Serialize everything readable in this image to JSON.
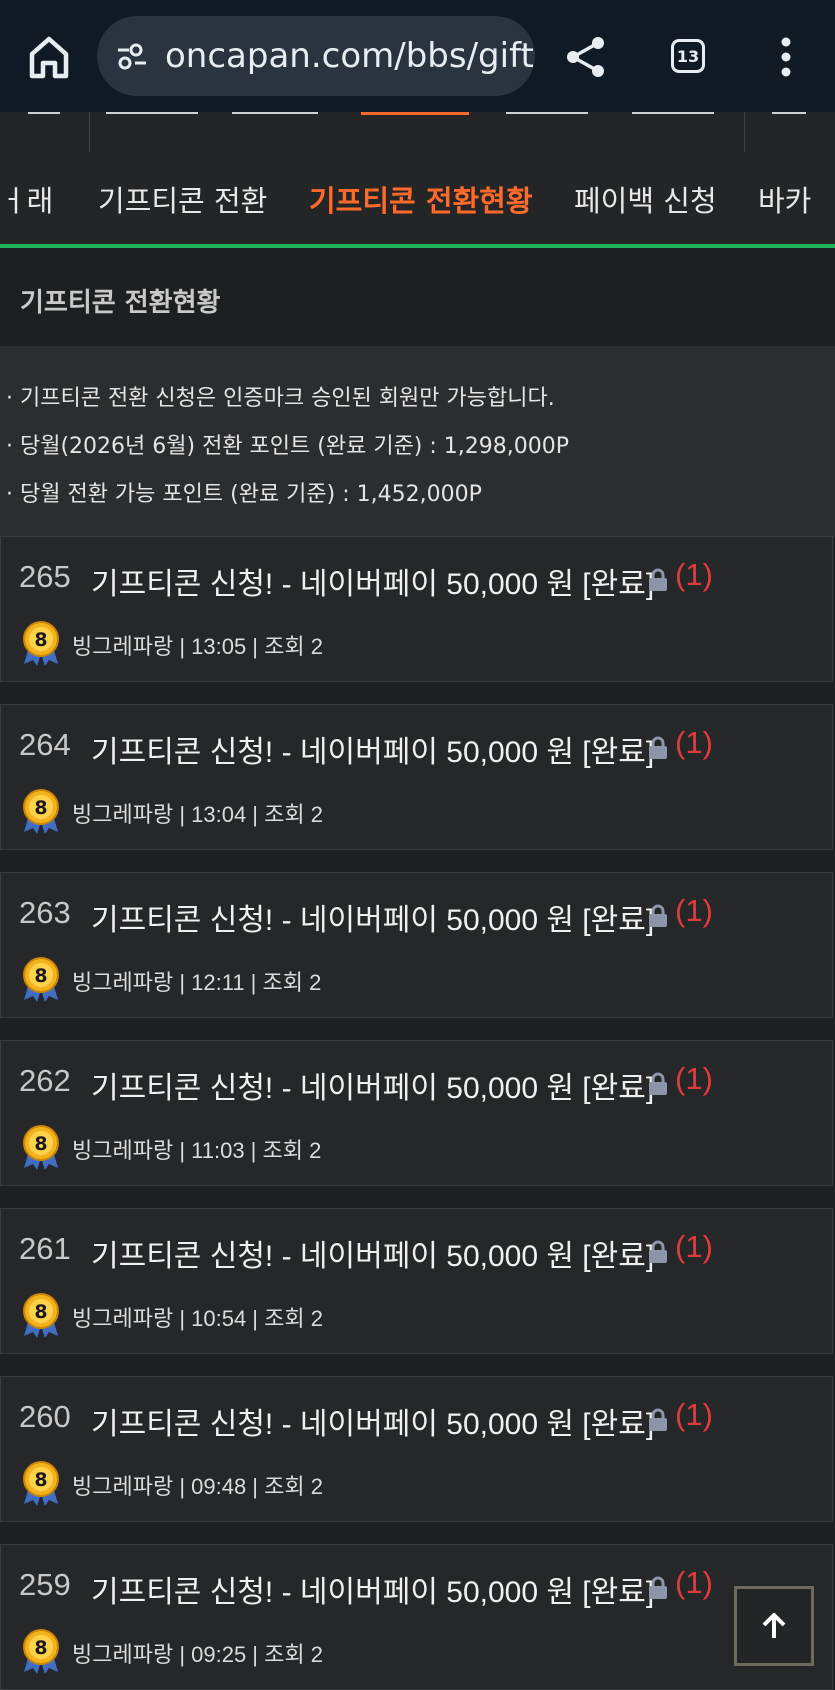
{
  "browser": {
    "url": "oncapan.com/bbs/gift",
    "tab_count": "13"
  },
  "subnav": {
    "tabs": [
      {
        "label": "ㅓ래"
      },
      {
        "label": "기프티콘 전환"
      },
      {
        "label": "기프티콘 전환현황",
        "active": true
      },
      {
        "label": "페이백 신청"
      },
      {
        "label": "바카"
      }
    ]
  },
  "section": {
    "title": "기프티콘 전환현황"
  },
  "notice": {
    "lines": [
      "· 기프티콘 전환 신청은 인증마크 승인된 회원만 가능합니다.",
      "·  당월(2026년 6월) 전환 포인트 (완료 기준) : 1,298,000P",
      "·  당월 전환 가능 포인트 (완료 기준) : 1,452,000P"
    ]
  },
  "posts": [
    {
      "num": "265",
      "title": "기프티콘 신청! - 네이버페이 50,000 원 [완료]",
      "comments": "(1)",
      "level": "8",
      "meta": "빙그레파랑 | 13:05 | 조회 2"
    },
    {
      "num": "264",
      "title": "기프티콘 신청! - 네이버페이 50,000 원 [완료]",
      "comments": "(1)",
      "level": "8",
      "meta": "빙그레파랑 | 13:04 | 조회 2"
    },
    {
      "num": "263",
      "title": "기프티콘 신청! - 네이버페이 50,000 원 [완료]",
      "comments": "(1)",
      "level": "8",
      "meta": "빙그레파랑 | 12:11 | 조회 2"
    },
    {
      "num": "262",
      "title": "기프티콘 신청! - 네이버페이 50,000 원 [완료]",
      "comments": "(1)",
      "level": "8",
      "meta": "빙그레파랑 | 11:03 | 조회 2"
    },
    {
      "num": "261",
      "title": "기프티콘 신청! - 네이버페이 50,000 원 [완료]",
      "comments": "(1)",
      "level": "8",
      "meta": "빙그레파랑 | 10:54 | 조회 2"
    },
    {
      "num": "260",
      "title": "기프티콘 신청! - 네이버페이 50,000 원 [완료]",
      "comments": "(1)",
      "level": "8",
      "meta": "빙그레파랑 | 09:48 | 조회 2"
    },
    {
      "num": "259",
      "title": "기프티콘 신청! - 네이버페이 50,000 원 [완료]",
      "comments": "(1)",
      "level": "8",
      "meta": "빙그레파랑 | 09:25 | 조회 2"
    }
  ],
  "colors": {
    "accent": "#ff6a2b",
    "divider": "#1fb35c",
    "comment": "#e23b3b",
    "background": "#1d1f20"
  },
  "icons": {
    "home": "home-icon",
    "tune": "tune-icon",
    "share": "share-icon",
    "menu": "more-vert-icon",
    "lock": "lock-icon",
    "badge": "level-badge-icon",
    "scroll_top": "arrow-up-icon"
  }
}
